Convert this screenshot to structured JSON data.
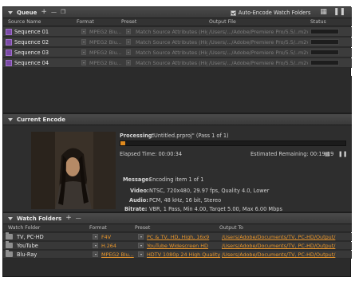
{
  "queue": {
    "title": "Queue",
    "auto_encode_label": "Auto-Encode Watch Folders",
    "columns": [
      "Source Name",
      "Format",
      "Preset",
      "Output File",
      "Status"
    ],
    "rows": [
      {
        "name": "Sequence 01",
        "format": "MPEG2 Blu...",
        "preset": "Match Source Attributes (Hig...",
        "output": "/Users/.../Adobe/Premiere Pro/5.5/..m2v"
      },
      {
        "name": "Sequence 02",
        "format": "MPEG2 Blu...",
        "preset": "Match Source Attributes (Hig...",
        "output": "/Users/.../Adobe/Premiere Pro/5.5/..m2v"
      },
      {
        "name": "Sequence 03",
        "format": "MPEG2 Blu...",
        "preset": "Match Source Attributes (Hig...",
        "output": "/Users/.../Adobe/Premiere Pro/5.5/..m2v"
      },
      {
        "name": "Sequence 04",
        "format": "MPEG2 Blu...",
        "preset": "Match Source Attributes (Hig...",
        "output": "/Users/.../Adobe/Premiere Pro/5.5/..m2v"
      }
    ]
  },
  "encode": {
    "title": "Current Encode",
    "processing_label": "Processing:",
    "processing_value": "\"Untitled.prproj\" (Pass 1 of 1)",
    "progress": 0.02,
    "elapsed": "Elapsed Time: 00:00:34",
    "remaining": "Estimated Remaining: 00:19:19",
    "message_label": "Message:",
    "message_value": "Encoding item 1 of 1",
    "video_label": "Video:",
    "video_value": "NTSC, 720x480, 29.97 fps, Quality 4.0, Lower",
    "audio_label": "Audio:",
    "audio_value": "PCM, 48 kHz, 16 bit, Stereo",
    "bitrate_label": "Bitrate:",
    "bitrate_value": "VBR, 1 Pass, Min 4.00, Target 5.00, Max 6.00 Mbps"
  },
  "watch": {
    "title": "Watch Folders",
    "columns": [
      "Watch Folder",
      "Format",
      "Preset",
      "Output To"
    ],
    "rows": [
      {
        "name": "TV, PC-HD",
        "format": "F4V",
        "preset": "PC & TV, HD, High, 16x9",
        "output": "/Users/Adobe/Documents/TV, PC-HD/Output/"
      },
      {
        "name": "YouTube",
        "format": "H.264",
        "preset": "YouTube Widescreen HD",
        "output": "/Users/Adobe/Documents/TV, PC-HD/Output/"
      },
      {
        "name": "Blu-Ray",
        "format": "MPEG2 Blu...",
        "preset": "HDTV 1080p 24 High Quality",
        "output": "/Users/Adobe/Documents/TV, PC-HD/Output/"
      }
    ]
  },
  "colors": {
    "accent": "#e8962c",
    "progress": "#e08a1e",
    "panel": "#2b2b2b"
  }
}
